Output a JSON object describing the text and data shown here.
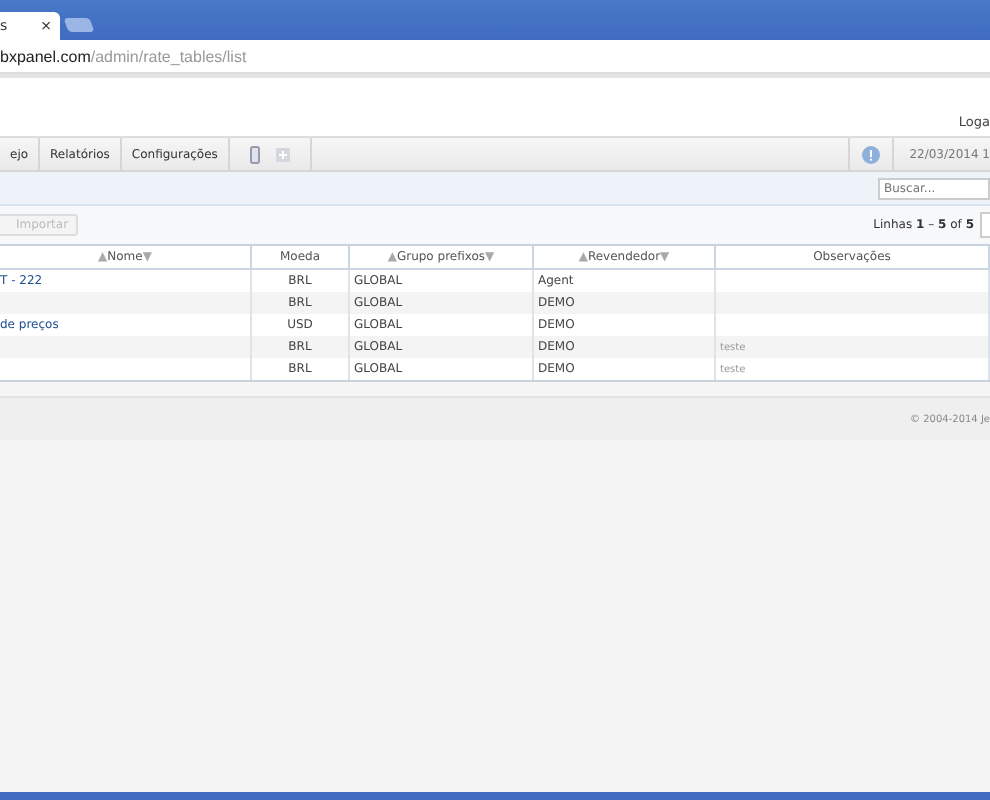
{
  "browser": {
    "tab_title": "s",
    "tab_close": "×",
    "address_domain": "bxpanel.com",
    "address_path": "/admin/rate_tables/list"
  },
  "header": {
    "login_link": "Loga"
  },
  "nav": {
    "items": [
      {
        "label": "ejo"
      },
      {
        "label": "Relatórios"
      },
      {
        "label": "Configurações"
      }
    ],
    "date": "22/03/2014 1"
  },
  "search": {
    "placeholder": "Buscar..."
  },
  "toolbar": {
    "import_button": "Importar",
    "row_count": "Linhas **1** – **5** of **5**"
  },
  "table": {
    "columns": [
      {
        "label": "Nome",
        "sort_up": "▲",
        "sort_down": "▼"
      },
      {
        "label": "Moeda"
      },
      {
        "label": "Grupo prefixos",
        "sort_up": "▲",
        "sort_down": "▼"
      },
      {
        "label": "Revendedor",
        "sort_up": "▲",
        "sort_down": "▼"
      },
      {
        "label": "Observações"
      }
    ],
    "rows": [
      {
        "name": "T - 222",
        "currency": "BRL",
        "prefix_group": "GLOBAL",
        "reseller": "Agent"
      },
      {
        "currency": "BRL",
        "prefix_group": "GLOBAL",
        "reseller": "DEMO"
      },
      {
        "name": "de preços",
        "currency": "USD",
        "prefix_group": "GLOBAL",
        "reseller": "DEMO"
      },
      {
        "currency": "BRL",
        "prefix_group": "GLOBAL",
        "reseller": "DEMO",
        "notes": "teste"
      },
      {
        "currency": "BRL",
        "prefix_group": "GLOBAL",
        "reseller": "DEMO",
        "notes": "teste"
      }
    ]
  },
  "footer": {
    "copyright": "© 2004-2014 Je"
  }
}
